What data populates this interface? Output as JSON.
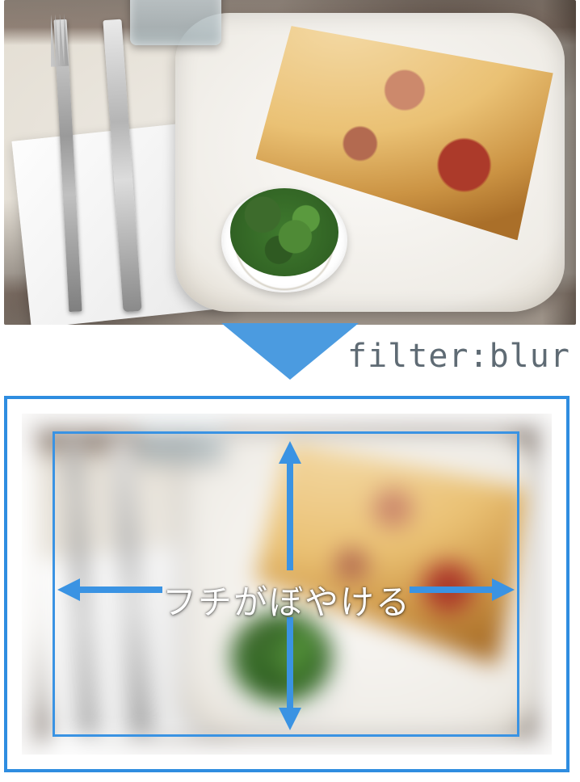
{
  "filter_label": "filter:blur",
  "blur_caption": "フチがぼやける",
  "colors": {
    "accent_blue": "#3a93e3",
    "arrow_blue_fill": "#4b9be0",
    "label_gray": "#5f6b74"
  },
  "photo_subject": "pizza slice on white plate with basil cup, fork and knife on napkin",
  "arrows": [
    "up",
    "down",
    "left",
    "right"
  ]
}
